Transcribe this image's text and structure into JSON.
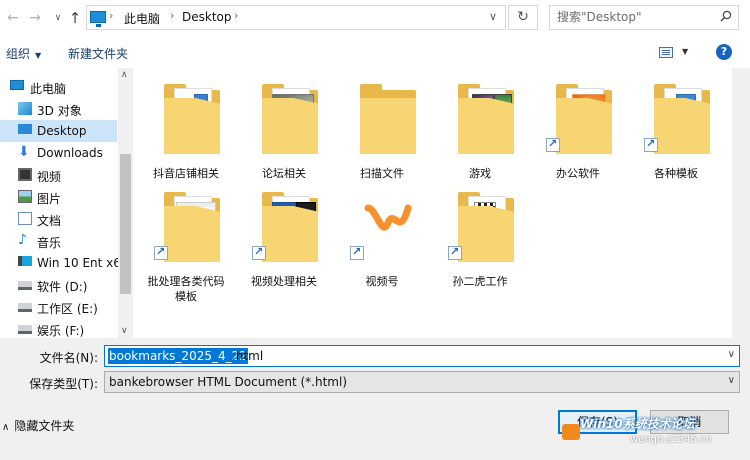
{
  "address_bar": {
    "crumbs": [
      "此电脑",
      "Desktop"
    ],
    "search_placeholder": "搜索\"Desktop\""
  },
  "toolbar": {
    "organize_label": "组织",
    "new_folder_label": "新建文件夹"
  },
  "nav": {
    "items": [
      {
        "label": "此电脑",
        "icon": "computer-icon"
      },
      {
        "label": "3D 对象",
        "icon": "3d-objects-icon"
      },
      {
        "label": "Desktop",
        "icon": "desktop-icon",
        "selected": true
      },
      {
        "label": "Downloads",
        "icon": "download-icon"
      },
      {
        "label": "视频",
        "icon": "video-icon"
      },
      {
        "label": "图片",
        "icon": "pictures-icon"
      },
      {
        "label": "文档",
        "icon": "documents-icon"
      },
      {
        "label": "音乐",
        "icon": "music-icon"
      },
      {
        "label": "Win 10 Ent x64",
        "icon": "windows-drive-icon"
      },
      {
        "label": "软件 (D:)",
        "icon": "drive-icon"
      },
      {
        "label": "工作区 (E:)",
        "icon": "drive-icon"
      },
      {
        "label": "娱乐 (F:)",
        "icon": "drive-icon"
      }
    ]
  },
  "files": [
    {
      "label": "抖音店铺相关",
      "kind": "folder",
      "shortcut": false
    },
    {
      "label": "论坛相关",
      "kind": "folder",
      "shortcut": false
    },
    {
      "label": "扫描文件",
      "kind": "folder",
      "shortcut": false
    },
    {
      "label": "游戏",
      "kind": "folder",
      "shortcut": false
    },
    {
      "label": "办公软件",
      "kind": "folder",
      "shortcut": true
    },
    {
      "label": "各种模板",
      "kind": "folder",
      "shortcut": true
    },
    {
      "label": "批处理各类代码",
      "label2": "模板",
      "kind": "folder",
      "shortcut": true
    },
    {
      "label": "视频处理相关",
      "kind": "folder",
      "shortcut": true
    },
    {
      "label": "视频号",
      "kind": "app",
      "shortcut": true
    },
    {
      "label": "孙二虎工作",
      "kind": "folder",
      "shortcut": true
    }
  ],
  "form": {
    "filename_label": "文件名(N):",
    "filename_selected": "bookmarks_2025_4_22",
    "filename_ext": ".html",
    "filetype_label": "保存类型(T):",
    "filetype_value": "bankebrowser HTML Document (*.html)",
    "hide_folders_label": "隐藏文件夹",
    "save_label": "保存(S)",
    "cancel_label": "取消"
  },
  "watermark": {
    "text": "Win10系统技术论坛",
    "sub": "wenqo.s2345.cn"
  },
  "colors": {
    "accent": "#0078d7",
    "selection": "#cce4f7",
    "folder": "#f7d572",
    "help": "#1565c0"
  }
}
